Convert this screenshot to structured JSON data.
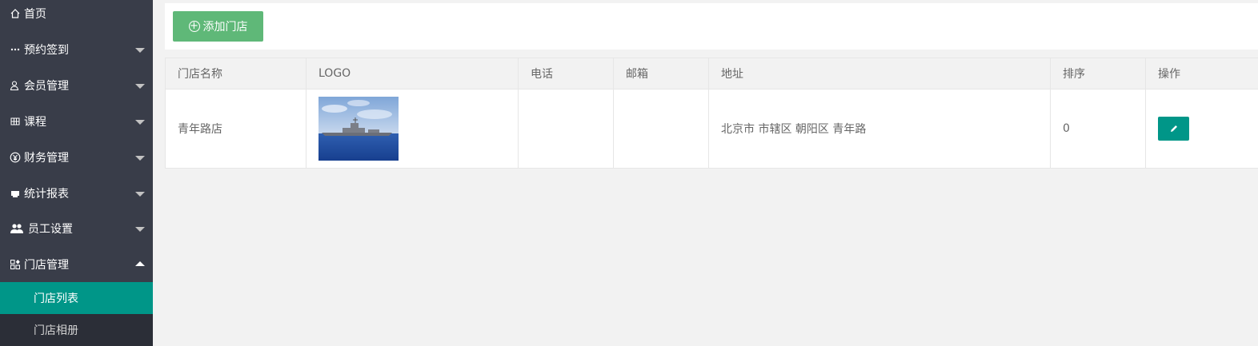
{
  "sidebar": {
    "items": [
      {
        "label": "首页",
        "icon": "home-icon"
      },
      {
        "label": "预约签到",
        "icon": "dots-icon"
      },
      {
        "label": "会员管理",
        "icon": "user-icon"
      },
      {
        "label": "课程",
        "icon": "grid-icon"
      },
      {
        "label": "财务管理",
        "icon": "yen-icon"
      },
      {
        "label": "统计报表",
        "icon": "chart-icon"
      },
      {
        "label": "员工设置",
        "icon": "users-icon"
      },
      {
        "label": "门店管理",
        "icon": "store-icon"
      }
    ],
    "subitems": [
      {
        "label": "门店列表",
        "active": true
      },
      {
        "label": "门店相册",
        "active": false
      }
    ]
  },
  "toolbar": {
    "add_label": "添加门店"
  },
  "table": {
    "headers": [
      "门店名称",
      "LOGO",
      "电话",
      "邮箱",
      "地址",
      "排序",
      "操作"
    ],
    "rows": [
      {
        "name": "青年路店",
        "phone": "",
        "email": "",
        "address": "北京市 市辖区 朝阳区 青年路",
        "sort": "0"
      }
    ]
  },
  "colors": {
    "sidebar_bg": "#393d49",
    "active": "#009688",
    "add_button": "#5fb878"
  }
}
